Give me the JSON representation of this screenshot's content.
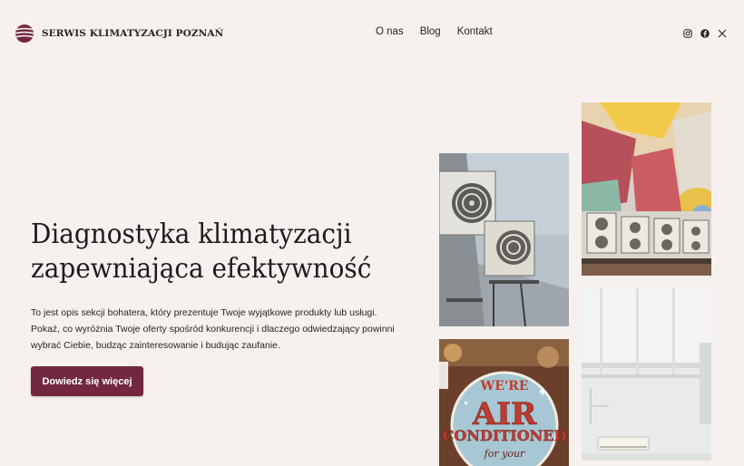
{
  "brand": {
    "name": "SERWIS KLIMATYZACJI POZNAŃ",
    "accent_color": "#72283f",
    "background_color": "#f6f1ee"
  },
  "nav": {
    "items": [
      {
        "label": "O nas"
      },
      {
        "label": "Blog"
      },
      {
        "label": "Kontakt"
      }
    ]
  },
  "social": {
    "icons": [
      "instagram-icon",
      "facebook-icon",
      "x-twitter-icon"
    ]
  },
  "hero": {
    "title_line1": "Diagnostyka klimatyzacji",
    "title_line2": "zapewniająca efektywność",
    "description": "To jest opis sekcji bohatera, który prezentuje Twoje wyjątkowe produkty lub usługi. Pokaż, co wyróżnia Twoje oferty spośród konkurencji i dlaczego odwiedzający powinni wybrać Ciebie, budząc zainteresowanie i budując zaufanie.",
    "cta_label": "Dowiedz się więcej"
  },
  "gallery": {
    "sign_line1": "WE'RE",
    "sign_line2": "AIR",
    "sign_line3": "CONDITIONED",
    "sign_line4": "for your"
  }
}
